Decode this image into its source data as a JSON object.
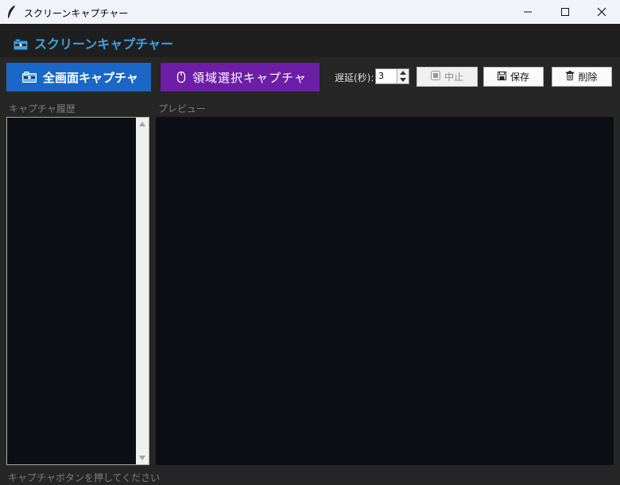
{
  "window": {
    "title": "スクリーンキャプチャー",
    "icons": {
      "app": "feather-icon",
      "minimize": "minimize-icon",
      "maximize": "maximize-icon",
      "close": "close-icon"
    }
  },
  "header": {
    "title": "スクリーンキャプチャー",
    "icon": "camera-icon",
    "accent_color": "#3ea0e4"
  },
  "toolbar": {
    "fullscreen_label": "全画面キャプチャ",
    "fullscreen_icon": "camera-icon",
    "fullscreen_color": "#1a67c8",
    "region_label": "領域選択キャプチャ",
    "region_icon": "mouse-icon",
    "region_color": "#6d1ea7",
    "delay_label": "遅延(秒):",
    "delay_value": "3",
    "stop_label": "中止",
    "stop_icon": "stop-icon",
    "save_label": "保存",
    "save_icon": "floppy-icon",
    "delete_label": "削除",
    "delete_icon": "trash-icon"
  },
  "history": {
    "label": "キャプチャ履歴"
  },
  "preview": {
    "label": "プレビュー"
  },
  "status": {
    "text": "キャプチャボタンを押してください"
  }
}
